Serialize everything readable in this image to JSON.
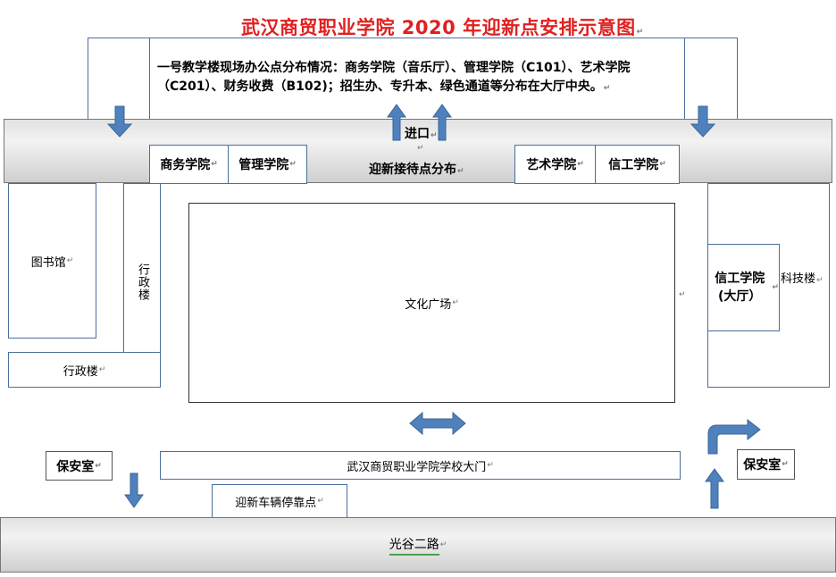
{
  "title": "武汉商贸职业学院 2020 年迎新点安排示意图",
  "notice": "一号教学楼现场办公点分布情况：商务学院（音乐厅）、管理学院（C101）、艺术学院（C201）、财务收费（B102)；招生办、专升本、绿色通道等分布在大厅中央。",
  "entrance": "进口",
  "reception_band": "迎新接待点分布",
  "colleges_left": [
    "商务学院",
    "管理学院"
  ],
  "colleges_right": [
    "艺术学院",
    "信工学院"
  ],
  "library": "图书馆",
  "admin_vertical": "行政楼",
  "admin_horizontal": "行政楼",
  "plaza": "文化广场",
  "it_college_hall": "信工学院(大厅）",
  "tech_building": "科技楼",
  "gate": "武汉商贸职业学院学校大门",
  "security_left": "保安室",
  "security_right": "保安室",
  "parking": "迎新车辆停靠点",
  "road": "光谷二路",
  "colors": {
    "title": "#e02020",
    "arrow": "#4f81bd",
    "border": "#4a6f9a"
  }
}
